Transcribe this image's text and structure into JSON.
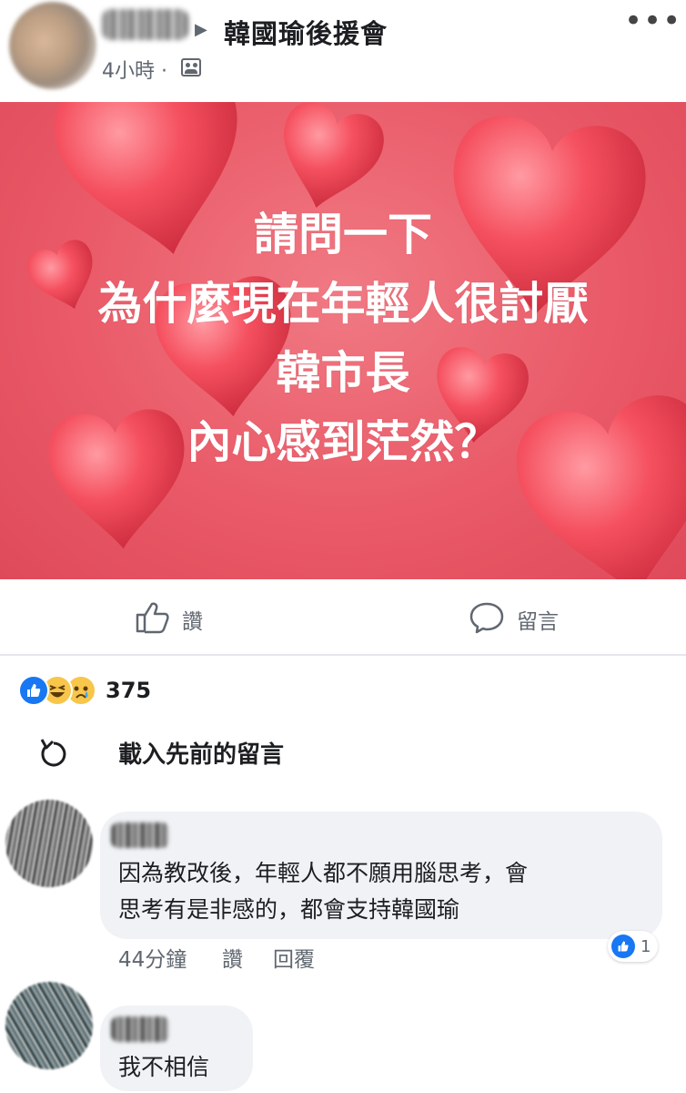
{
  "post": {
    "group_name": "韓國瑜後援會",
    "time": "4小時 ·",
    "image_lines": [
      "請問一下",
      "為什麼現在年輕人很討厭",
      "韓市長",
      "內心感到茫然？"
    ]
  },
  "actions": {
    "like_label": "讚",
    "comment_label": "留言"
  },
  "reactions": {
    "icons": [
      "like-icon",
      "haha-icon",
      "sad-icon"
    ],
    "count": "375"
  },
  "load_previous": {
    "label": "載入先前的留言"
  },
  "comments": [
    {
      "text_lines": [
        "因為教改後，年輕人都不願用腦思考，會",
        "思考有是非感的，都會支持韓國瑜"
      ],
      "time": "44分鐘",
      "like_label": "讚",
      "reply_label": "回覆",
      "like_count": "1"
    },
    {
      "text_lines": [
        "我不相信"
      ]
    }
  ],
  "colors": {
    "brand_blue": "#1877f2",
    "image_bg": "#ea5a68",
    "bubble_bg": "#f0f2f5",
    "secondary_text": "#606770"
  }
}
